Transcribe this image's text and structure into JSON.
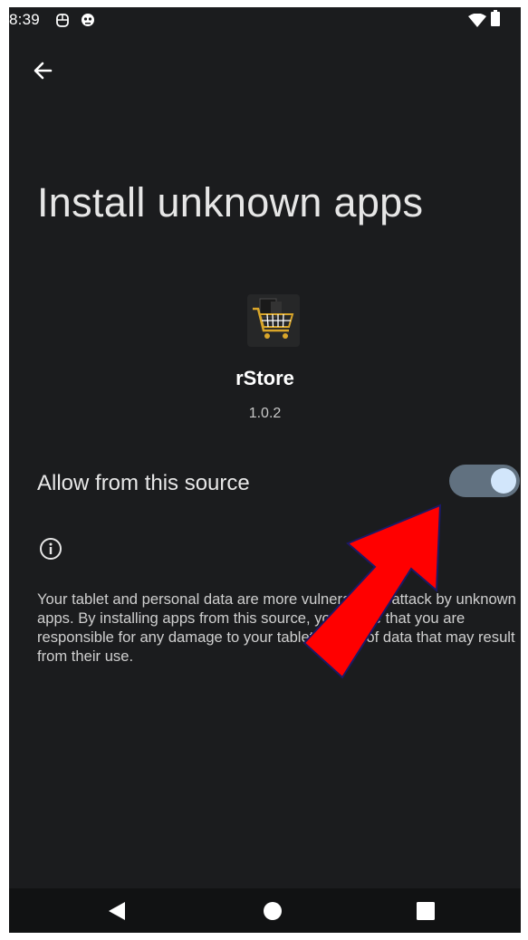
{
  "status_bar": {
    "time": "8:39"
  },
  "header": {
    "title": "Install unknown apps"
  },
  "app": {
    "name": "rStore",
    "version": "1.0.2"
  },
  "setting": {
    "label": "Allow from this source",
    "enabled": true
  },
  "info": {
    "text": "Your tablet and personal data are more vulnerable to attack by unknown apps. By installing apps from this source, you agree that you are responsible for any damage to your tablet or loss of data that may result from their use."
  },
  "colors": {
    "background": "#1b1c1e",
    "toggle_track": "#617180",
    "toggle_thumb": "#d2e6fb",
    "annotation_arrow": "#ff0000"
  },
  "icons": {
    "back": "arrow-left-icon",
    "info": "info-circle-icon",
    "app": "shopping-cart-icon",
    "nav_back": "triangle-back-icon",
    "nav_home": "circle-home-icon",
    "nav_recents": "square-recents-icon"
  }
}
